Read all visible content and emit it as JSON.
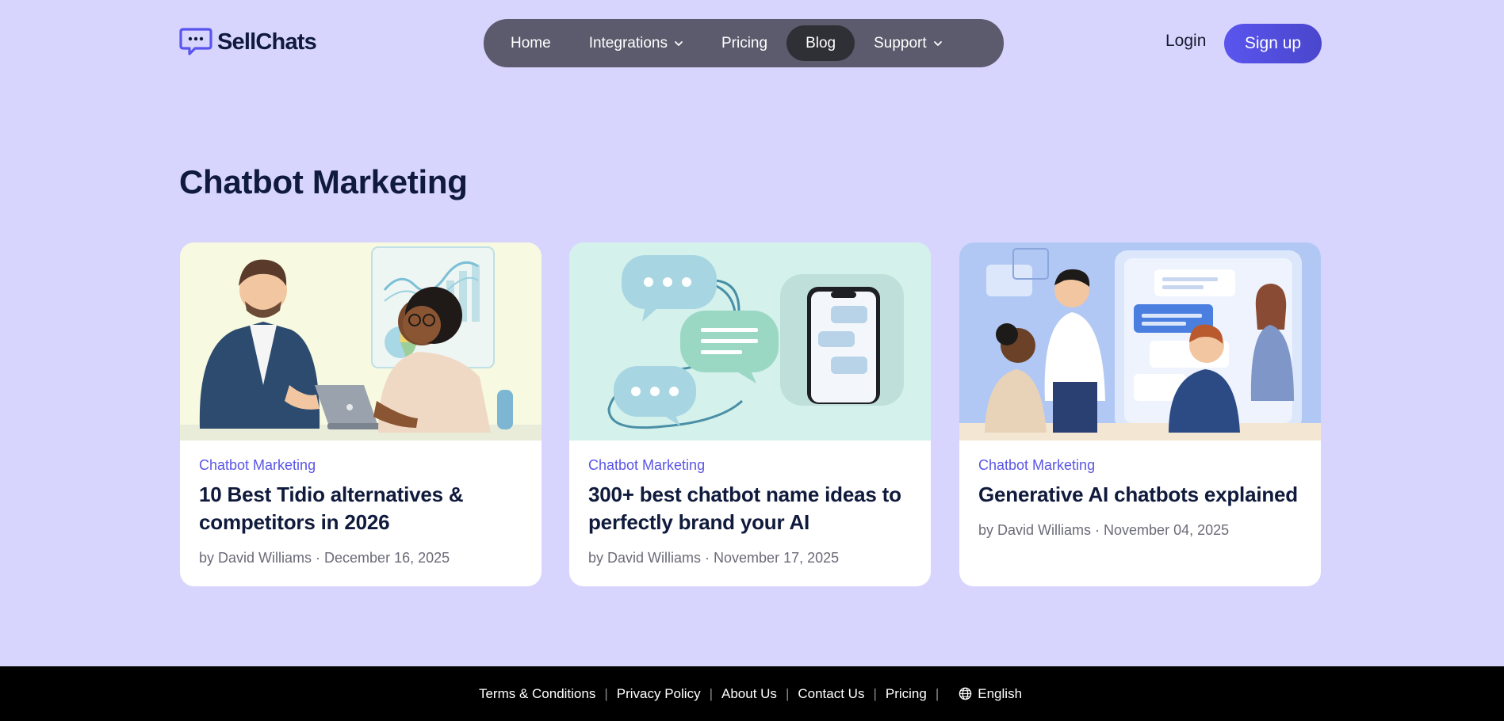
{
  "brand": {
    "name": "SellChats",
    "accent": "#5a55ee"
  },
  "nav": {
    "items": [
      {
        "label": "Home",
        "has_dropdown": false
      },
      {
        "label": "Integrations",
        "has_dropdown": true
      },
      {
        "label": "Pricing",
        "has_dropdown": false
      },
      {
        "label": "Blog",
        "has_dropdown": false,
        "active": true
      },
      {
        "label": "Support",
        "has_dropdown": true
      }
    ]
  },
  "auth": {
    "login_label": "Login",
    "signup_label": "Sign up"
  },
  "page": {
    "title": "Chatbot Marketing"
  },
  "cards": [
    {
      "category": "Chatbot Marketing",
      "title": "10 Best Tidio alternatives & competitors in 2026",
      "author": "by David Williams",
      "date": "December 16, 2025",
      "image": "two-colleagues-laptop-illustration"
    },
    {
      "category": "Chatbot Marketing",
      "title": "300+ best chatbot name ideas to perfectly brand your AI",
      "author": "by David Williams",
      "date": "November 17, 2025",
      "image": "chat-bubbles-phone-illustration"
    },
    {
      "category": "Chatbot Marketing",
      "title": "Generative AI chatbots explained",
      "author": "by David Williams",
      "date": "November 04, 2025",
      "image": "team-meeting-chat-screen-illustration"
    }
  ],
  "footer": {
    "links": [
      "Terms & Conditions",
      "Privacy Policy",
      "About Us",
      "Contact Us",
      "Pricing"
    ],
    "language": "English"
  }
}
